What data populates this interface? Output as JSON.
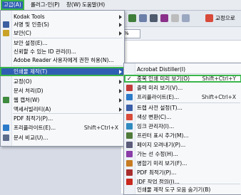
{
  "menubar": [
    "고급(A)",
    "롤러그-인(P)",
    "창(W)",
    "도움말(H)"
  ],
  "toolbar": {
    "right_button_label": "교정으로",
    "zoom_value": "%"
  },
  "main_menu": [
    {
      "label": "Kodak Tools",
      "icon": "none",
      "arrow": true
    },
    {
      "label": "서명 및 인증(S)",
      "icon": "pen-icon",
      "arrow": true
    },
    {
      "label": "보안(C)",
      "icon": "lock-icon",
      "arrow": true
    },
    {
      "label": "보안 설정(E)...",
      "icon": "none",
      "arrow": false
    },
    {
      "label": "신뢰할 수 있는 ID 관리(I)...",
      "icon": "none",
      "arrow": false
    },
    {
      "label": "Adobe Reader 사용자에게 권한 허용(N)...",
      "icon": "none",
      "arrow": false
    },
    {
      "label": "인쇄물 제작(T)",
      "icon": "none",
      "arrow": true,
      "highlight": true
    },
    {
      "label": "교정(O)",
      "icon": "none",
      "arrow": true
    },
    {
      "label": "문서 처리(D)",
      "icon": "none",
      "arrow": true
    },
    {
      "label": "웹 캡처(W)",
      "icon": "globe-icon",
      "arrow": true
    },
    {
      "label": "액세서빌리티(A)",
      "icon": "none",
      "arrow": true
    },
    {
      "label": "PDF 최적기(P)...",
      "icon": "none",
      "arrow": false
    },
    {
      "label": "프리플라이트(E)...",
      "icon": "preflight-icon",
      "shortcut": "Shift+Ctrl+X"
    },
    {
      "label": "문서 비교(U)...",
      "icon": "compare-icon",
      "arrow": false
    }
  ],
  "sub_menu": [
    {
      "label": "Acrobat Distiller(I)",
      "icon": "none"
    },
    {
      "label": "중복 인쇄 미리 보기(O)",
      "icon": "check",
      "shortcut": "Shift+Ctrl+Y",
      "highlight": true
    },
    {
      "label": "출력 미리 보기(V)...",
      "icon": "output-icon"
    },
    {
      "label": "프리플라이트(E)...",
      "icon": "preflight-icon",
      "shortcut": "Shift+Ctrl+X"
    },
    {
      "label": "트랩 사전 설정(T)...",
      "icon": "trap-icon"
    },
    {
      "label": "색상 변환(C)...",
      "icon": "color-icon"
    },
    {
      "label": "잉크 관리자(I)...",
      "icon": "ink-icon"
    },
    {
      "label": "프린터 표시 추가(M)...",
      "icon": "marks-icon"
    },
    {
      "label": "페이지 오려내기(P)...",
      "icon": "crop-icon"
    },
    {
      "label": "가는 선 수정(H)...",
      "icon": "line-icon"
    },
    {
      "label": "병합기 미리 보기(F)...",
      "icon": "flatten-icon"
    },
    {
      "label": "PDF 최적기(P)...",
      "icon": "optimize-icon"
    },
    {
      "label": "JDF 작업 정의(J)...",
      "icon": "jdf-icon"
    },
    {
      "label": "인쇄물 제작 도구 모음 숨기기(B)",
      "icon": "none"
    }
  ]
}
